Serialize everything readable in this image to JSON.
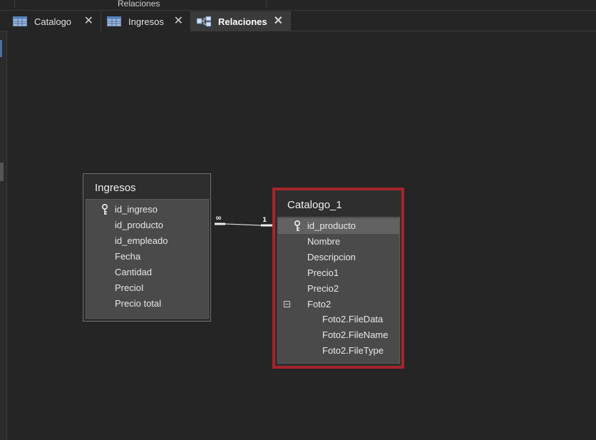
{
  "window": {
    "title": "Relaciones"
  },
  "tabs": [
    {
      "label": "Catalogo",
      "icon": "table-icon",
      "active": false
    },
    {
      "label": "Ingresos",
      "icon": "table-icon",
      "active": false
    },
    {
      "label": "Relaciones",
      "icon": "relationships-icon",
      "active": true
    }
  ],
  "tables": {
    "ingresos": {
      "title": "Ingresos",
      "fields": [
        "id_ingreso",
        "id_producto",
        "id_empleado",
        "Fecha",
        "Cantidad",
        "PrecioI",
        "Precio total"
      ],
      "primary_key": "id_ingreso"
    },
    "catalogo": {
      "title": "Catalogo_1",
      "fields": [
        "id_producto",
        "Nombre",
        "Descripcion",
        "Precio1",
        "Precio2",
        "Foto2"
      ],
      "subfields": [
        "Foto2.FileData",
        "Foto2.FileName",
        "Foto2.FileType"
      ],
      "primary_key": "id_producto",
      "selected": true
    }
  },
  "relationship": {
    "many_label": "∞",
    "one_label": "1"
  },
  "colors": {
    "background": "#252525",
    "selection_border": "#a3262b",
    "field_panel": "#4a4a4a"
  }
}
